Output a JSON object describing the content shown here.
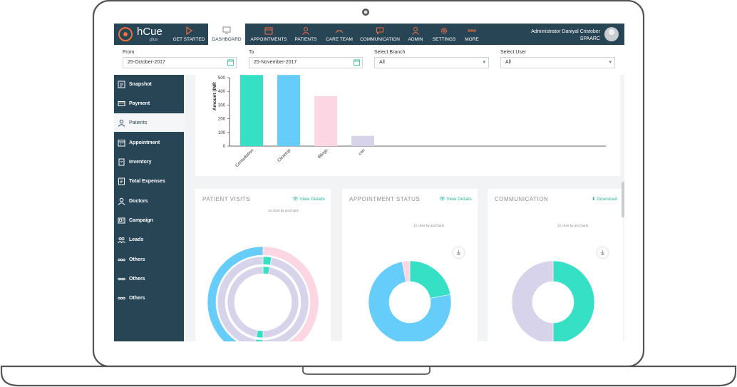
{
  "app": {
    "logo_text": "hCue",
    "logo_sub": "plus"
  },
  "nav": {
    "items": [
      {
        "label": "GET STARTED",
        "icon": "play-icon"
      },
      {
        "label": "DASHBOARD",
        "icon": "dashboard-icon",
        "active": true
      },
      {
        "label": "APPOINTMENTS",
        "icon": "calendar-icon"
      },
      {
        "label": "PATIENTS",
        "icon": "user-icon"
      },
      {
        "label": "CARE TEAM",
        "icon": "care-team-icon"
      },
      {
        "label": "COMMUNICATION",
        "icon": "chat-icon"
      },
      {
        "label": "ADMIN",
        "icon": "admin-icon"
      },
      {
        "label": "SETTINGS",
        "icon": "gear-icon"
      },
      {
        "label": "MORE",
        "icon": "more-icon"
      }
    ],
    "user_name": "Administrator Daniyal Cristober",
    "user_org": "SPAARC"
  },
  "filters": {
    "from_label": "From",
    "from_value": "25-October-2017",
    "to_label": "To",
    "to_value": "25-November-2017",
    "branch_label": "Select Branch",
    "branch_value": "All",
    "user_label": "Select User",
    "user_value": "All"
  },
  "sidebar": {
    "items": [
      {
        "label": "Snapshot",
        "icon": "snapshot-icon"
      },
      {
        "label": "Payment",
        "icon": "payment-icon"
      },
      {
        "label": "Patients",
        "icon": "patient-icon",
        "active": true
      },
      {
        "label": "Appointment",
        "icon": "appointment-icon"
      },
      {
        "label": "Inventory",
        "icon": "inventory-icon"
      },
      {
        "label": "Total Expenses",
        "icon": "expenses-icon"
      },
      {
        "label": "Doctors",
        "icon": "doctor-icon"
      },
      {
        "label": "Campaign",
        "icon": "campaign-icon"
      },
      {
        "label": "Leads",
        "icon": "leads-icon"
      },
      {
        "label": "Others",
        "icon": "dots-icon"
      },
      {
        "label": "Others",
        "icon": "dots-icon"
      },
      {
        "label": "Others",
        "icon": "dots-icon"
      }
    ]
  },
  "colors": {
    "navy": "#284556",
    "teal": "#35e0c4",
    "blue": "#66ccf9",
    "pink": "#fcd6e2",
    "lavender": "#d7d3ea",
    "link": "#2bb39a"
  },
  "cards": {
    "patient_visits": {
      "title": "PATIENT VISITS",
      "link": "View Details",
      "credit": "JS chart by amCharts"
    },
    "appointment_status": {
      "title": "APPOINTMENT STATUS",
      "link": "View Details",
      "credit": "JS chart by amCharts"
    },
    "communication": {
      "title": "COMMUNICATION",
      "link": "Download",
      "credit": "JS chart by amCharts"
    }
  },
  "chart_data": [
    {
      "type": "bar",
      "ylabel": "Amount (INR",
      "ylim": [
        0,
        500
      ],
      "yticks": [
        0,
        100,
        200,
        300,
        400,
        500
      ],
      "categories": [
        "Consultation",
        "CleanUp",
        "fillings",
        "con"
      ],
      "values": [
        520,
        520,
        365,
        75
      ],
      "colors": [
        "#35e0c4",
        "#66ccf9",
        "#fcd6e2",
        "#d7d3ea"
      ],
      "grid": false
    },
    {
      "type": "pie",
      "title": "",
      "rings": [
        {
          "values": [
            40,
            60
          ],
          "colors": [
            "#fcd6e2",
            "#66ccf9"
          ]
        },
        {
          "values": [
            3,
            47,
            3,
            47
          ],
          "colors": [
            "#35e0c4",
            "#d7d3ea",
            "#35e0c4",
            "#d7d3ea"
          ]
        },
        {
          "values": [
            3,
            47,
            3,
            47
          ],
          "colors": [
            "#35e0c4",
            "#d7d3ea",
            "#35e0c4",
            "#d7d3ea"
          ]
        }
      ]
    },
    {
      "type": "pie",
      "title": "",
      "slices": [
        {
          "value": 22,
          "color": "#35e0c4"
        },
        {
          "value": 75,
          "color": "#66ccf9"
        },
        {
          "value": 3,
          "color": "#fcd6e2"
        }
      ]
    },
    {
      "type": "pie",
      "title": "",
      "slices": [
        {
          "value": 50,
          "color": "#35e0c4"
        },
        {
          "value": 50,
          "color": "#d7d3ea"
        }
      ]
    }
  ]
}
